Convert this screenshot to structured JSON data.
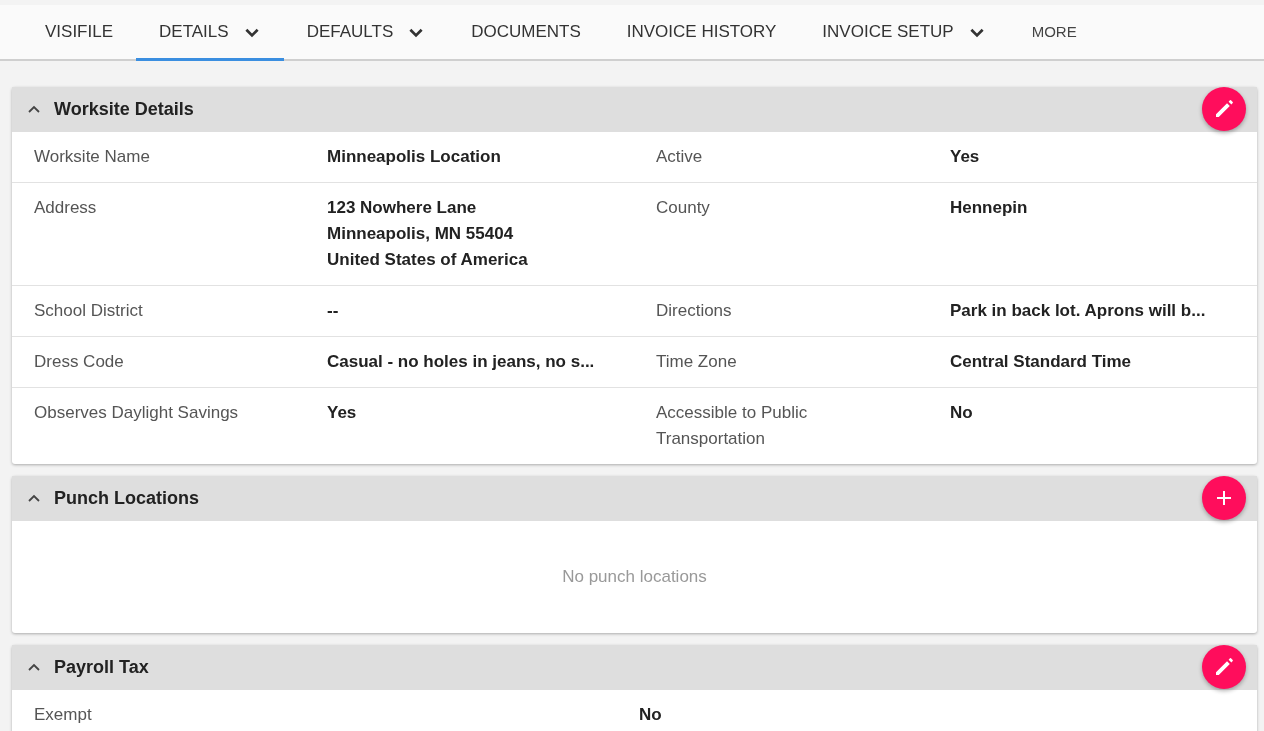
{
  "tabs": [
    {
      "label": "VISIFILE",
      "selected": false,
      "dropdown": false,
      "kind": "tab"
    },
    {
      "label": "DETAILS",
      "selected": true,
      "dropdown": true,
      "kind": "tab"
    },
    {
      "label": "DEFAULTS",
      "selected": false,
      "dropdown": true,
      "kind": "tab"
    },
    {
      "label": "DOCUMENTS",
      "selected": false,
      "dropdown": false,
      "kind": "tab"
    },
    {
      "label": "INVOICE HISTORY",
      "selected": false,
      "dropdown": false,
      "kind": "tab"
    },
    {
      "label": "INVOICE SETUP",
      "selected": false,
      "dropdown": true,
      "kind": "tab"
    },
    {
      "label": "MORE",
      "selected": false,
      "dropdown": false,
      "kind": "more"
    }
  ],
  "sections": [
    {
      "title": "Worksite Details",
      "expanded": true,
      "action": {
        "kind": "edit"
      },
      "kind": "grid",
      "rows": [
        {
          "label": "Worksite Name",
          "value": "Minneapolis Location",
          "label_2": "Active",
          "value_2": "Yes"
        },
        {
          "label": "Address",
          "value": "123 Nowhere Lane\nMinneapolis, MN 55404\nUnited States of America",
          "label_2": "County",
          "value_2": "Hennepin"
        },
        {
          "label": "School District",
          "value": "--",
          "label_2": "Directions",
          "value_2": "Park in back lot. Aprons will b..."
        },
        {
          "label": "Dress Code",
          "value": "Casual - no holes in jeans, no s...",
          "label_2": "Time Zone",
          "value_2": "Central Standard Time"
        },
        {
          "label": "Observes Daylight Savings",
          "value": "Yes",
          "label_2": "Accessible to Public\nTransportation",
          "value_2": "No"
        }
      ]
    },
    {
      "title": "Punch Locations",
      "expanded": true,
      "action": {
        "kind": "add"
      },
      "kind": "empty",
      "message": "No punch locations"
    },
    {
      "title": "Payroll Tax",
      "expanded": true,
      "action": {
        "kind": "edit"
      },
      "kind": "pairs",
      "rows": [
        {
          "label": "Exempt",
          "value": "No"
        }
      ]
    }
  ]
}
